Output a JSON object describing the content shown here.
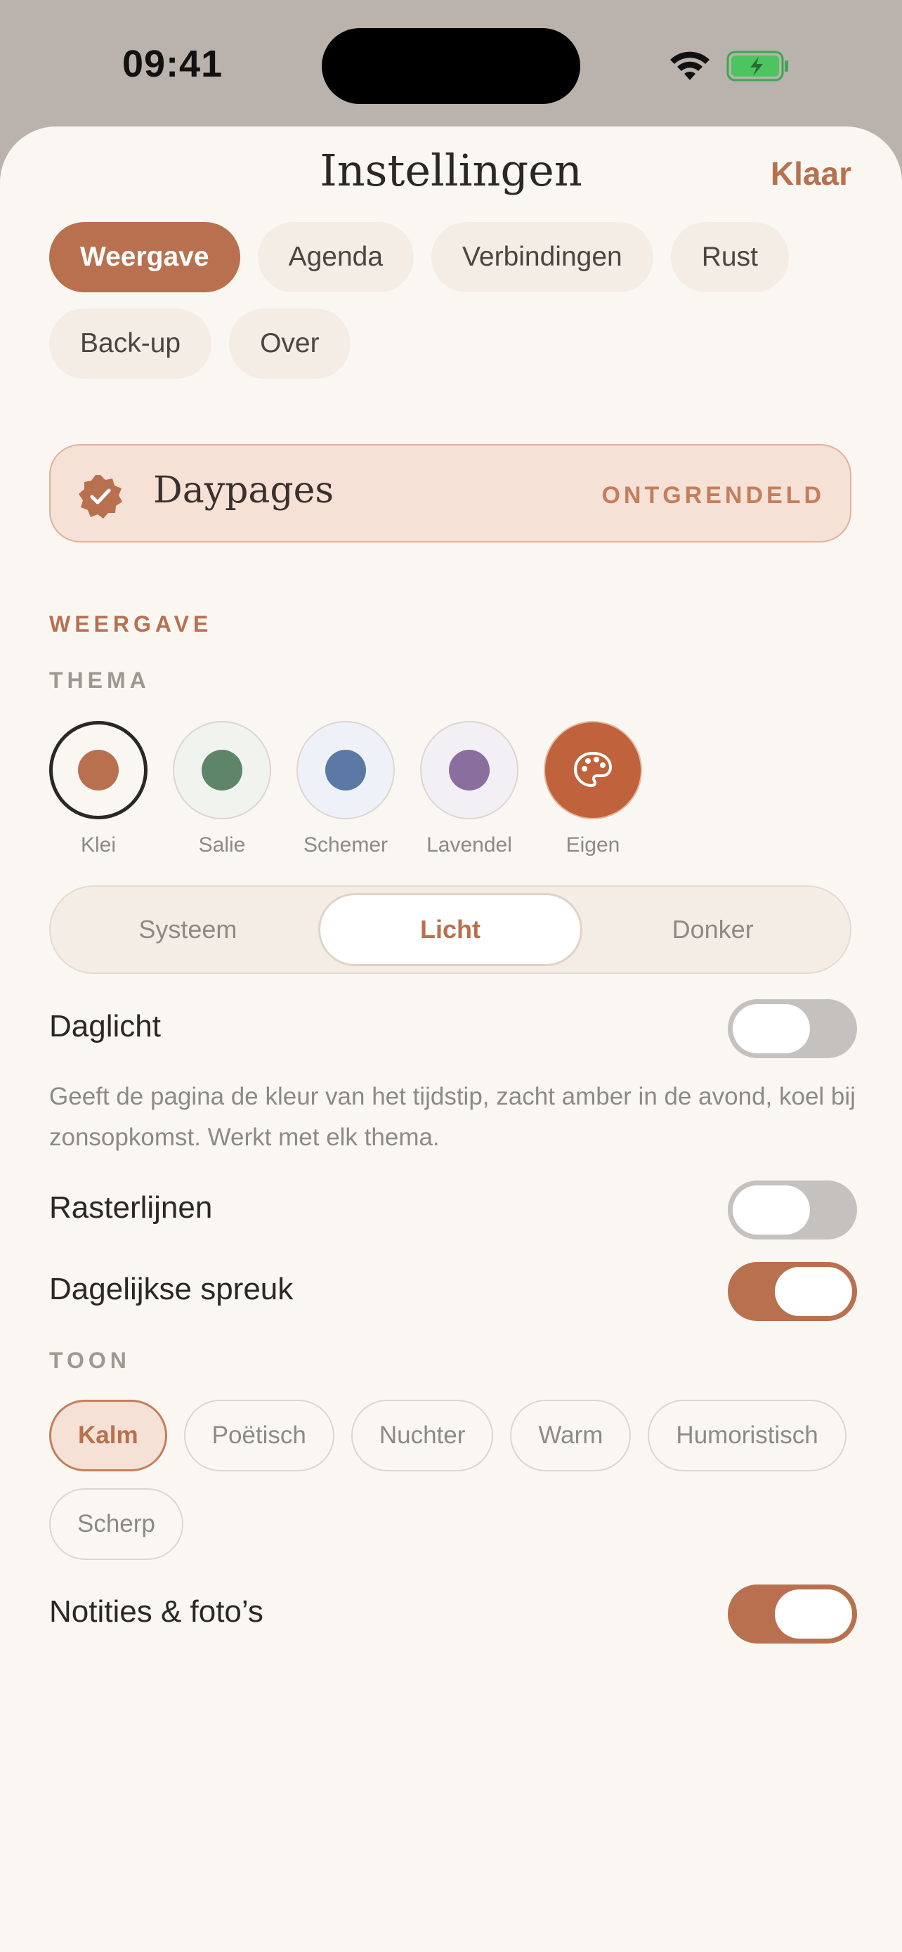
{
  "status_bar": {
    "time": "09:41"
  },
  "header": {
    "title": "Instellingen",
    "done_label": "Klaar"
  },
  "tabs": [
    {
      "label": "Weergave",
      "active": true
    },
    {
      "label": "Agenda",
      "active": false
    },
    {
      "label": "Verbindingen",
      "active": false
    },
    {
      "label": "Rust",
      "active": false
    },
    {
      "label": "Back-up",
      "active": false
    },
    {
      "label": "Over",
      "active": false
    }
  ],
  "pro_banner": {
    "name": "Daypages",
    "status": "ONTGRENDELD"
  },
  "section": {
    "title": "WEERGAVE",
    "theme_label": "THEMA",
    "tone_label": "TOON"
  },
  "themes": [
    {
      "label": "Klei",
      "color": "#b8704f",
      "selected": true
    },
    {
      "label": "Salie",
      "color": "#5e8568",
      "selected": false
    },
    {
      "label": "Schemer",
      "color": "#5b79a4",
      "selected": false
    },
    {
      "label": "Lavendel",
      "color": "#8a6e9e",
      "selected": false
    },
    {
      "label": "Eigen",
      "color": "#c0623c",
      "icon": "palette-icon",
      "selected": false
    }
  ],
  "appearance": {
    "options": [
      "Systeem",
      "Licht",
      "Donker"
    ],
    "selected": "Licht"
  },
  "daylight": {
    "label": "Daglicht",
    "enabled": false,
    "description": "Geeft de pagina de kleur van het tijdstip, zacht amber in de avond, koel bij zonsopkomst. Werkt met elk thema."
  },
  "gridlines": {
    "label": "Rasterlijnen",
    "enabled": false
  },
  "daily_quote": {
    "label": "Dagelijkse spreuk",
    "enabled": true
  },
  "tones": [
    {
      "label": "Kalm",
      "active": true
    },
    {
      "label": "Poëtisch",
      "active": false
    },
    {
      "label": "Nuchter",
      "active": false
    },
    {
      "label": "Warm",
      "active": false
    },
    {
      "label": "Humoristisch",
      "active": false
    },
    {
      "label": "Scherp",
      "active": false
    }
  ],
  "notes_photos": {
    "label": "Notities & foto’s",
    "enabled": true
  },
  "colors": {
    "accent": "#b8704f",
    "background": "#faf7f3",
    "banner": "#f6e1d6"
  }
}
